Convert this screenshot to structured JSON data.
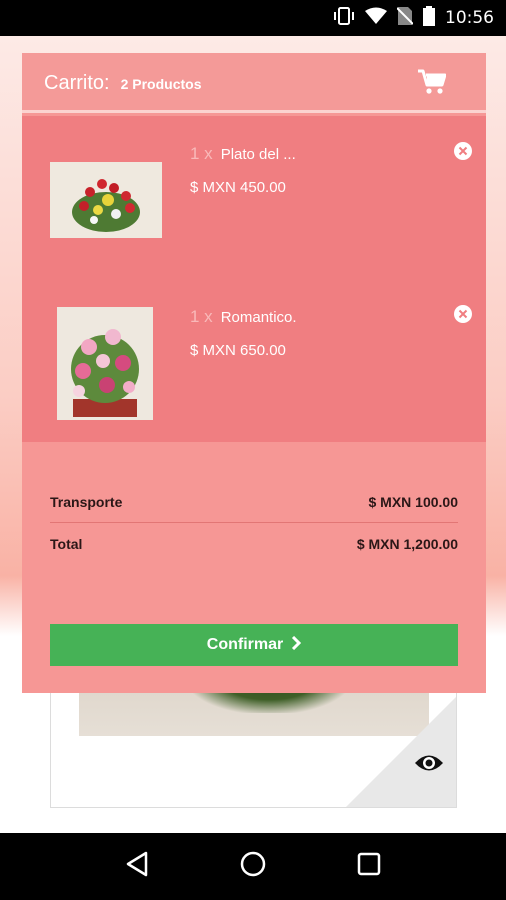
{
  "status_bar": {
    "time": "10:56",
    "icons": [
      "vibrate-icon",
      "wifi-icon",
      "no-sim-icon",
      "battery-icon"
    ]
  },
  "cart": {
    "title": "Carrito:",
    "count_label": "2 Productos",
    "icon": "cart-icon",
    "items": [
      {
        "qty": "1 x",
        "name": "Plato del ...",
        "price": "$ MXN 450.00",
        "thumb": "flower-arrangement-photo-red-yellow"
      },
      {
        "qty": "1 x",
        "name": "Romantico.",
        "price": "$ MXN 650.00",
        "thumb": "flower-arrangement-photo-pink"
      }
    ],
    "shipping_label": "Transporte",
    "shipping_value": "$ MXN 100.00",
    "total_label": "Total",
    "total_value": "$ MXN 1,200.00",
    "confirm_label": "Confirmar",
    "colors": {
      "header": "#f49a98",
      "items_bg": "#f07e81",
      "panel_bg": "#f69795",
      "confirm": "#46b256"
    }
  },
  "background": {
    "eye_icon": "eye-icon"
  },
  "nav_bar": {
    "icons": [
      "back-icon",
      "home-icon",
      "recents-icon"
    ]
  }
}
